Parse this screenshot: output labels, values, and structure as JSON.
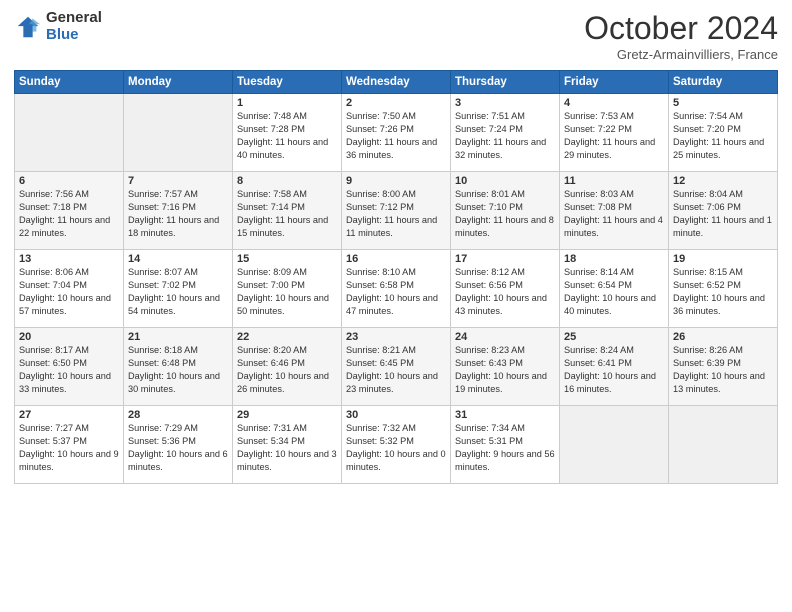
{
  "logo": {
    "general": "General",
    "blue": "Blue"
  },
  "header": {
    "month": "October 2024",
    "location": "Gretz-Armainvilliers, France"
  },
  "days_of_week": [
    "Sunday",
    "Monday",
    "Tuesday",
    "Wednesday",
    "Thursday",
    "Friday",
    "Saturday"
  ],
  "weeks": [
    [
      {
        "day": "",
        "sunrise": "",
        "sunset": "",
        "daylight": "",
        "empty": true
      },
      {
        "day": "",
        "sunrise": "",
        "sunset": "",
        "daylight": "",
        "empty": true
      },
      {
        "day": "1",
        "sunrise": "Sunrise: 7:48 AM",
        "sunset": "Sunset: 7:28 PM",
        "daylight": "Daylight: 11 hours and 40 minutes."
      },
      {
        "day": "2",
        "sunrise": "Sunrise: 7:50 AM",
        "sunset": "Sunset: 7:26 PM",
        "daylight": "Daylight: 11 hours and 36 minutes."
      },
      {
        "day": "3",
        "sunrise": "Sunrise: 7:51 AM",
        "sunset": "Sunset: 7:24 PM",
        "daylight": "Daylight: 11 hours and 32 minutes."
      },
      {
        "day": "4",
        "sunrise": "Sunrise: 7:53 AM",
        "sunset": "Sunset: 7:22 PM",
        "daylight": "Daylight: 11 hours and 29 minutes."
      },
      {
        "day": "5",
        "sunrise": "Sunrise: 7:54 AM",
        "sunset": "Sunset: 7:20 PM",
        "daylight": "Daylight: 11 hours and 25 minutes."
      }
    ],
    [
      {
        "day": "6",
        "sunrise": "Sunrise: 7:56 AM",
        "sunset": "Sunset: 7:18 PM",
        "daylight": "Daylight: 11 hours and 22 minutes."
      },
      {
        "day": "7",
        "sunrise": "Sunrise: 7:57 AM",
        "sunset": "Sunset: 7:16 PM",
        "daylight": "Daylight: 11 hours and 18 minutes."
      },
      {
        "day": "8",
        "sunrise": "Sunrise: 7:58 AM",
        "sunset": "Sunset: 7:14 PM",
        "daylight": "Daylight: 11 hours and 15 minutes."
      },
      {
        "day": "9",
        "sunrise": "Sunrise: 8:00 AM",
        "sunset": "Sunset: 7:12 PM",
        "daylight": "Daylight: 11 hours and 11 minutes."
      },
      {
        "day": "10",
        "sunrise": "Sunrise: 8:01 AM",
        "sunset": "Sunset: 7:10 PM",
        "daylight": "Daylight: 11 hours and 8 minutes."
      },
      {
        "day": "11",
        "sunrise": "Sunrise: 8:03 AM",
        "sunset": "Sunset: 7:08 PM",
        "daylight": "Daylight: 11 hours and 4 minutes."
      },
      {
        "day": "12",
        "sunrise": "Sunrise: 8:04 AM",
        "sunset": "Sunset: 7:06 PM",
        "daylight": "Daylight: 11 hours and 1 minute."
      }
    ],
    [
      {
        "day": "13",
        "sunrise": "Sunrise: 8:06 AM",
        "sunset": "Sunset: 7:04 PM",
        "daylight": "Daylight: 10 hours and 57 minutes."
      },
      {
        "day": "14",
        "sunrise": "Sunrise: 8:07 AM",
        "sunset": "Sunset: 7:02 PM",
        "daylight": "Daylight: 10 hours and 54 minutes."
      },
      {
        "day": "15",
        "sunrise": "Sunrise: 8:09 AM",
        "sunset": "Sunset: 7:00 PM",
        "daylight": "Daylight: 10 hours and 50 minutes."
      },
      {
        "day": "16",
        "sunrise": "Sunrise: 8:10 AM",
        "sunset": "Sunset: 6:58 PM",
        "daylight": "Daylight: 10 hours and 47 minutes."
      },
      {
        "day": "17",
        "sunrise": "Sunrise: 8:12 AM",
        "sunset": "Sunset: 6:56 PM",
        "daylight": "Daylight: 10 hours and 43 minutes."
      },
      {
        "day": "18",
        "sunrise": "Sunrise: 8:14 AM",
        "sunset": "Sunset: 6:54 PM",
        "daylight": "Daylight: 10 hours and 40 minutes."
      },
      {
        "day": "19",
        "sunrise": "Sunrise: 8:15 AM",
        "sunset": "Sunset: 6:52 PM",
        "daylight": "Daylight: 10 hours and 36 minutes."
      }
    ],
    [
      {
        "day": "20",
        "sunrise": "Sunrise: 8:17 AM",
        "sunset": "Sunset: 6:50 PM",
        "daylight": "Daylight: 10 hours and 33 minutes."
      },
      {
        "day": "21",
        "sunrise": "Sunrise: 8:18 AM",
        "sunset": "Sunset: 6:48 PM",
        "daylight": "Daylight: 10 hours and 30 minutes."
      },
      {
        "day": "22",
        "sunrise": "Sunrise: 8:20 AM",
        "sunset": "Sunset: 6:46 PM",
        "daylight": "Daylight: 10 hours and 26 minutes."
      },
      {
        "day": "23",
        "sunrise": "Sunrise: 8:21 AM",
        "sunset": "Sunset: 6:45 PM",
        "daylight": "Daylight: 10 hours and 23 minutes."
      },
      {
        "day": "24",
        "sunrise": "Sunrise: 8:23 AM",
        "sunset": "Sunset: 6:43 PM",
        "daylight": "Daylight: 10 hours and 19 minutes."
      },
      {
        "day": "25",
        "sunrise": "Sunrise: 8:24 AM",
        "sunset": "Sunset: 6:41 PM",
        "daylight": "Daylight: 10 hours and 16 minutes."
      },
      {
        "day": "26",
        "sunrise": "Sunrise: 8:26 AM",
        "sunset": "Sunset: 6:39 PM",
        "daylight": "Daylight: 10 hours and 13 minutes."
      }
    ],
    [
      {
        "day": "27",
        "sunrise": "Sunrise: 7:27 AM",
        "sunset": "Sunset: 5:37 PM",
        "daylight": "Daylight: 10 hours and 9 minutes."
      },
      {
        "day": "28",
        "sunrise": "Sunrise: 7:29 AM",
        "sunset": "Sunset: 5:36 PM",
        "daylight": "Daylight: 10 hours and 6 minutes."
      },
      {
        "day": "29",
        "sunrise": "Sunrise: 7:31 AM",
        "sunset": "Sunset: 5:34 PM",
        "daylight": "Daylight: 10 hours and 3 minutes."
      },
      {
        "day": "30",
        "sunrise": "Sunrise: 7:32 AM",
        "sunset": "Sunset: 5:32 PM",
        "daylight": "Daylight: 10 hours and 0 minutes."
      },
      {
        "day": "31",
        "sunrise": "Sunrise: 7:34 AM",
        "sunset": "Sunset: 5:31 PM",
        "daylight": "Daylight: 9 hours and 56 minutes."
      },
      {
        "day": "",
        "sunrise": "",
        "sunset": "",
        "daylight": "",
        "empty": true
      },
      {
        "day": "",
        "sunrise": "",
        "sunset": "",
        "daylight": "",
        "empty": true
      }
    ]
  ]
}
